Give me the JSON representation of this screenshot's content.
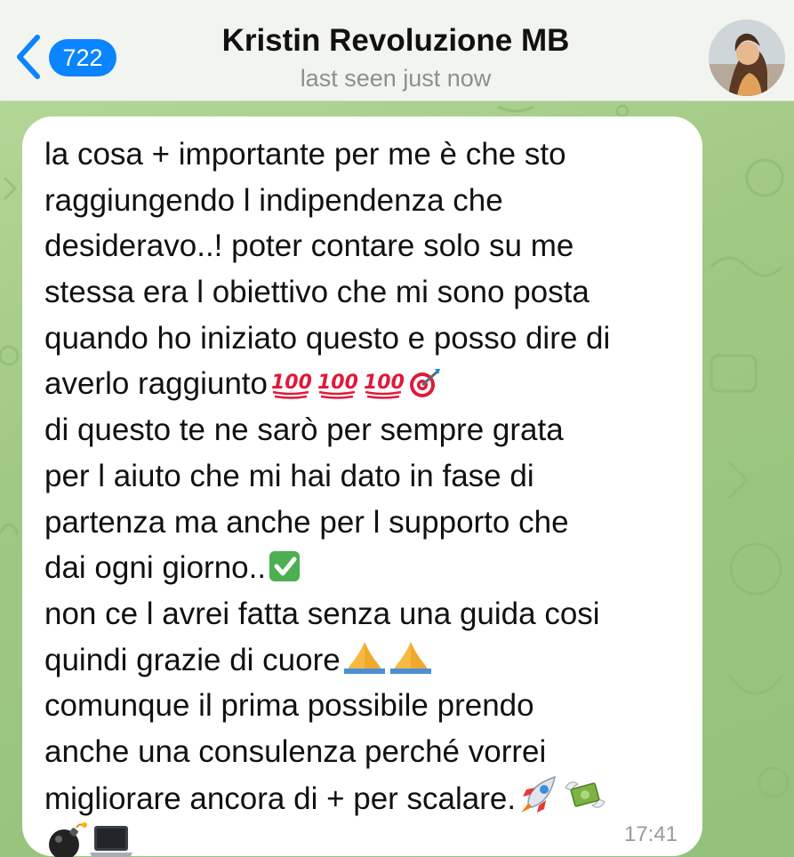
{
  "header": {
    "back_count": "722",
    "title": "Kristin Revoluzione MB",
    "status": "last seen just now"
  },
  "message": {
    "lines": [
      "la cosa + importante per me è che sto",
      "raggiungendo l indipendenza che",
      "desideravo..! poter contare solo su me",
      "stessa era l obiettivo che mi sono posta",
      "quando ho iniziato questo e posso dire di",
      "averlo raggiunto",
      "di questo te ne sarò per sempre grata",
      "per l aiuto che mi hai dato in fase di",
      "partenza ma anche per l supporto che",
      "dai ogni giorno..",
      "non ce l avrei fatta senza una guida cosi",
      "quindi grazie di cuore",
      "comunque il prima possibile prendo",
      "anche una consulenza perché vorrei",
      "migliorare ancora di + per scalare."
    ],
    "emoji": {
      "hundred": "hundred-points-emoji",
      "target": "direct-hit-emoji",
      "check": "check-mark-button-emoji",
      "pray": "folded-hands-emoji",
      "rocket": "rocket-emoji",
      "money": "money-with-wings-emoji",
      "bomb": "bomb-emoji",
      "laptop": "laptop-emoji",
      "hundred_glyph": "100"
    },
    "time": "17:41"
  },
  "colors": {
    "header_bg": "#f2f4ef",
    "accent": "#0a84ff",
    "wallpaper": "#a9cd8a",
    "bubble": "#ffffff"
  }
}
